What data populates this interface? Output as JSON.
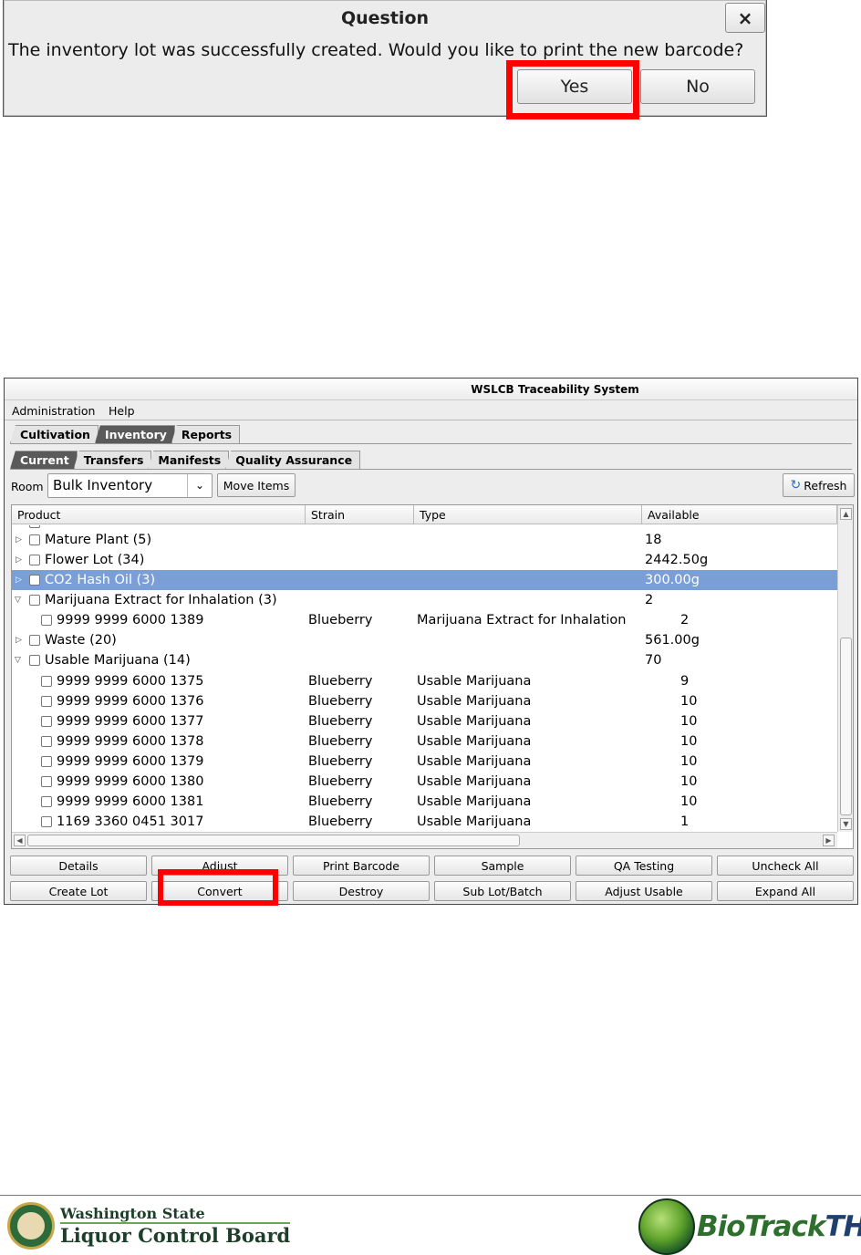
{
  "dialog": {
    "title": "Question",
    "close_label": "×",
    "message": "The inventory lot was successfully created. Would you like to print the new barcode?",
    "yes_label": "Yes",
    "no_label": "No"
  },
  "window": {
    "title": "WSLCB Traceability System",
    "menu": [
      "Administration",
      "Help"
    ],
    "main_tabs": [
      "Cultivation",
      "Inventory",
      "Reports"
    ],
    "sub_tabs": [
      "Current",
      "Transfers",
      "Manifests",
      "Quality Assurance"
    ],
    "room_label": "Room",
    "room_value": "Bulk Inventory",
    "move_items_label": "Move Items",
    "refresh_label": "Refresh",
    "columns": [
      "Product",
      "Strain",
      "Type",
      "Available"
    ],
    "rows": [
      {
        "product": "Mature Plant (5)",
        "strain": "",
        "type": "",
        "available": "18"
      },
      {
        "product": "Flower Lot (34)",
        "strain": "",
        "type": "",
        "available": "2442.50g"
      },
      {
        "product": "CO2 Hash Oil (3)",
        "strain": "",
        "type": "",
        "available": "300.00g"
      },
      {
        "product": "Marijuana Extract for Inhalation (3)",
        "strain": "",
        "type": "",
        "available": "2"
      },
      {
        "product": "9999 9999 6000 1389",
        "strain": "Blueberry",
        "type": "Marijuana Extract for Inhalation",
        "available": "2"
      },
      {
        "product": "Waste (20)",
        "strain": "",
        "type": "",
        "available": "561.00g"
      },
      {
        "product": "Usable Marijuana (14)",
        "strain": "",
        "type": "",
        "available": "70"
      },
      {
        "product": "9999 9999 6000 1375",
        "strain": "Blueberry",
        "type": "Usable Marijuana",
        "available": "9"
      },
      {
        "product": "9999 9999 6000 1376",
        "strain": "Blueberry",
        "type": "Usable Marijuana",
        "available": "10"
      },
      {
        "product": "9999 9999 6000 1377",
        "strain": "Blueberry",
        "type": "Usable Marijuana",
        "available": "10"
      },
      {
        "product": "9999 9999 6000 1378",
        "strain": "Blueberry",
        "type": "Usable Marijuana",
        "available": "10"
      },
      {
        "product": "9999 9999 6000 1379",
        "strain": "Blueberry",
        "type": "Usable Marijuana",
        "available": "10"
      },
      {
        "product": "9999 9999 6000 1380",
        "strain": "Blueberry",
        "type": "Usable Marijuana",
        "available": "10"
      },
      {
        "product": "9999 9999 6000 1381",
        "strain": "Blueberry",
        "type": "Usable Marijuana",
        "available": "10"
      },
      {
        "product": "1169 3360 0451 3017",
        "strain": "Blueberry",
        "type": "Usable Marijuana",
        "available": "1"
      }
    ],
    "buttons_row1": [
      "Details",
      "Adjust",
      "Print Barcode",
      "Sample",
      "QA Testing",
      "Uncheck All"
    ],
    "buttons_row2": [
      "Create Lot",
      "Convert",
      "Destroy",
      "Sub Lot/Batch",
      "Adjust Usable",
      "Expand All"
    ]
  },
  "footer": {
    "wslcb_line1": "Washington State",
    "wslcb_line2": "Liquor Control Board",
    "biotrack_part1": "BioTrack",
    "biotrack_part2": "THC"
  },
  "colors": {
    "highlight": "#ff0000",
    "selected_row": "#7a9fd7",
    "active_tab": "#5a5a5a"
  }
}
